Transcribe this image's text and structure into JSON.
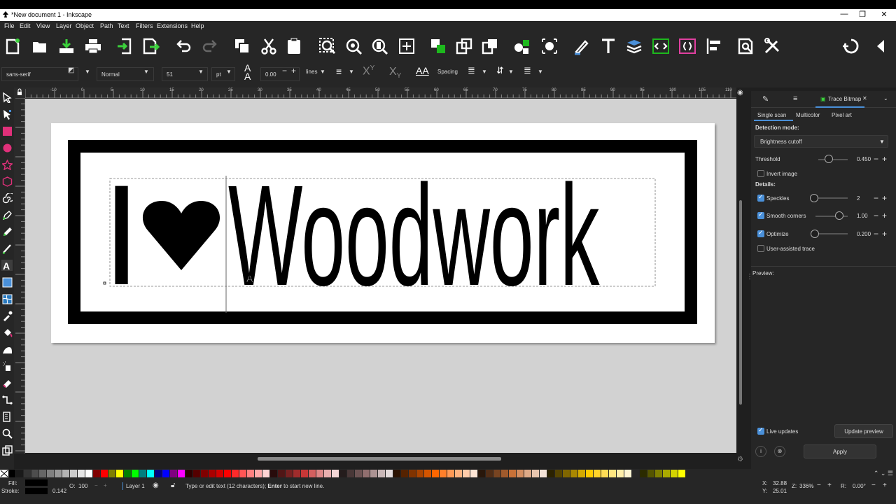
{
  "window": {
    "title": "*New document 1 - Inkscape",
    "minimize": "—",
    "maximize": "❐",
    "close": "✕"
  },
  "menu": [
    "File",
    "Edit",
    "View",
    "Layer",
    "Object",
    "Path",
    "Text",
    "Filters",
    "Extensions",
    "Help"
  ],
  "textbar": {
    "font_family": "sans-serif",
    "font_style": "Normal",
    "font_size": "51",
    "unit": "pt",
    "line_spacing": "0.00",
    "line_unit": "lines",
    "spacing_label": "Spacing"
  },
  "ruler": {
    "labels": [
      "-10",
      "0",
      "5",
      "10",
      "15",
      "20",
      "25",
      "30",
      "35",
      "40",
      "45",
      "50",
      "55",
      "60",
      "65",
      "70",
      "75",
      "80",
      "85",
      "90",
      "95",
      "100",
      "105",
      "110"
    ]
  },
  "canvas": {
    "text_i": "I",
    "text_heart": "♥",
    "text_word": "Woodwork"
  },
  "panel": {
    "active_tab": "Trace Bitmap",
    "modes": [
      "Single scan",
      "Multicolor",
      "Pixel art"
    ],
    "detection_label": "Detection mode:",
    "detection_value": "Brightness cutoff",
    "threshold_label": "Threshold",
    "threshold_value": "0.450",
    "invert_label": "Invert image",
    "details_label": "Details:",
    "speckles_label": "Speckles",
    "speckles_value": "2",
    "smooth_label": "Smooth corners",
    "smooth_value": "1.00",
    "optimize_label": "Optimize",
    "optimize_value": "0.200",
    "user_assisted_label": "User-assisted trace",
    "preview_label": "Preview:",
    "live_updates_label": "Live updates",
    "update_preview_label": "Update preview",
    "apply_label": "Apply"
  },
  "status": {
    "fill_label": "Fill:",
    "stroke_label": "Stroke:",
    "stroke_width": "0.142",
    "opacity_label": "O:",
    "opacity_value": "100",
    "layer": "Layer 1",
    "message_pre": "Type or edit text (12 characters); ",
    "message_bold": "Enter",
    "message_post": " to start new line.",
    "x_label": "X:",
    "x_value": "32.88",
    "y_label": "Y:",
    "y_value": "25.01",
    "zoom_label": "Z:",
    "zoom_value": "336%",
    "rotate_label": "R:",
    "rotate_value": "0.00°"
  },
  "palette_colors": [
    "#000000",
    "#1a1a1a",
    "#333333",
    "#4d4d4d",
    "#666666",
    "#808080",
    "#999999",
    "#b3b3b3",
    "#cccccc",
    "#e6e6e6",
    "#ffffff",
    "#800000",
    "#ff0000",
    "#808000",
    "#ffff00",
    "#008000",
    "#00ff00",
    "#008080",
    "#00ffff",
    "#000080",
    "#0000ff",
    "#800080",
    "#ff00ff",
    "#2b0000",
    "#550000",
    "#800000",
    "#aa0000",
    "#d40000",
    "#ff0000",
    "#ff2a2a",
    "#ff5555",
    "#ff8080",
    "#ffaaaa",
    "#ffd5d5",
    "#280b0b",
    "#501616",
    "#782121",
    "#a02c2c",
    "#c83737",
    "#d35f5f",
    "#de8787",
    "#e9afaf",
    "#f4d7d7",
    "#241c1c",
    "#483737",
    "#6c5353",
    "#916f6f",
    "#ac9393",
    "#c8b7b7",
    "#e3dbdb",
    "#2b1100",
    "#552200",
    "#803300",
    "#aa4400",
    "#d45500",
    "#ff6600",
    "#ff7f2a",
    "#ff9955",
    "#ffb380",
    "#ffccaa",
    "#ffe6d5",
    "#28170b",
    "#502d16",
    "#784421",
    "#a05a2c",
    "#c87137",
    "#d38d5f",
    "#deaa87",
    "#e9c6af",
    "#f4e3d7",
    "#2b2200",
    "#554400",
    "#806600",
    "#aa8800",
    "#d4aa00",
    "#ffcc00",
    "#ffd42a",
    "#ffdd55",
    "#ffe680",
    "#ffeeaa",
    "#fff6d5",
    "#282828",
    "#2b2b00",
    "#555500",
    "#808000",
    "#aaaa00",
    "#d4d400",
    "#ffff00"
  ],
  "colors": {
    "accent": "#4a90d9",
    "panel_bg": "#262626",
    "canvas_bg": "#d2d2d2",
    "page_bg": "#ffffff"
  }
}
